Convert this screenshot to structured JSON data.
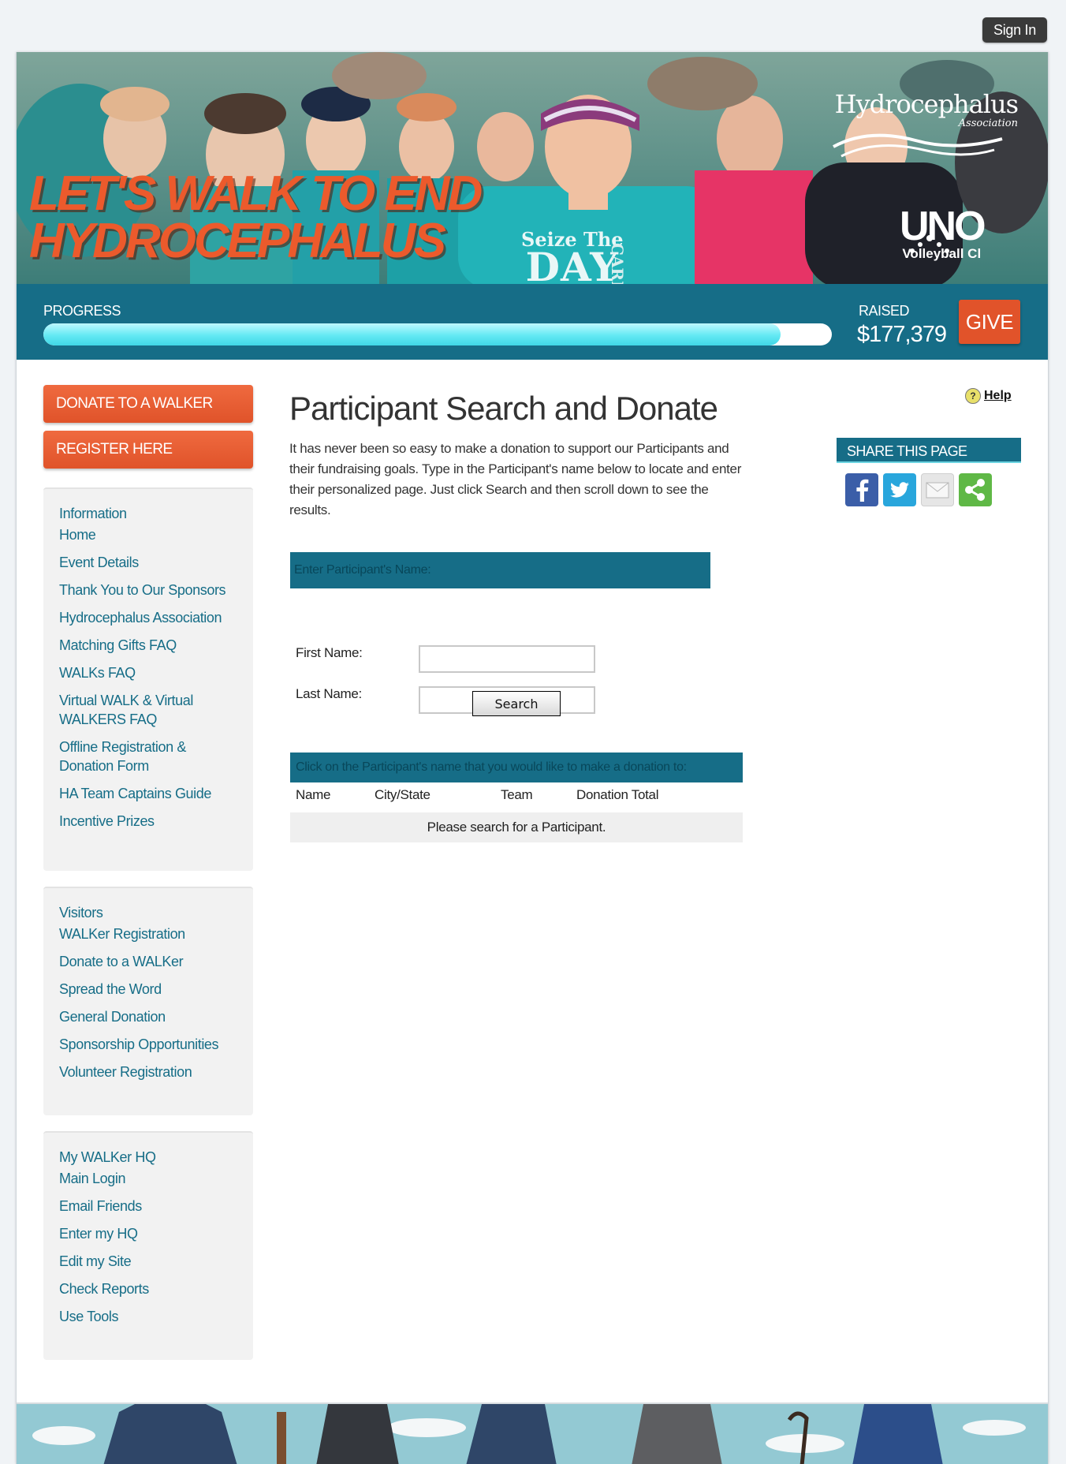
{
  "header": {
    "signin_label": "Sign In"
  },
  "banner": {
    "headline_line1": "LET'S WALK TO END",
    "headline_line2": "HYDROCEPHALUS",
    "tshirt_line1": "Seize The",
    "tshirt_line2": "DAY",
    "tshirt_line3": "CARP",
    "hoodie_line1": "UNO",
    "hoodie_line2": "Volleyball Cl",
    "logo_name": "Hydrocephalus",
    "logo_sub": "Association"
  },
  "progress": {
    "label": "PROGRESS",
    "fraction": 0.935,
    "raised_label": "RAISED",
    "raised_amount": "$177,379",
    "give_label": "GIVE"
  },
  "sidebar": {
    "donate_button": "DONATE TO A WALKER",
    "register_button": "REGISTER HERE",
    "sections": [
      {
        "heading": "Information",
        "items": [
          "Home",
          "Event Details",
          "Thank You to Our Sponsors",
          "Hydrocephalus Association",
          "Matching Gifts FAQ",
          "WALKs FAQ",
          "Virtual WALK & Virtual WALKERS FAQ",
          "Offline Registration & Donation Form",
          "HA Team Captains Guide",
          "Incentive Prizes"
        ]
      },
      {
        "heading": "Visitors",
        "items": [
          "WALKer Registration",
          "Donate to a WALKer",
          "Spread the Word",
          "General Donation",
          "Sponsorship Opportunities",
          "Volunteer Registration"
        ]
      },
      {
        "heading": "My WALKer HQ",
        "items": [
          "Main Login",
          "Email Friends",
          "Enter my HQ",
          "Edit my Site",
          "Check Reports",
          "Use Tools"
        ]
      }
    ]
  },
  "main": {
    "title": "Participant Search and Donate",
    "intro": "It has never been so easy to make a donation to support our Participants and their fundraising goals. Type in the Participant's name below to locate and enter their personalized page. Just click Search and then scroll down to see the results.",
    "help_label": "Help",
    "share_heading": "SHARE THIS PAGE",
    "share_icons": [
      "facebook-icon",
      "twitter-icon",
      "email-icon",
      "share-icon"
    ],
    "form": {
      "heading": "Enter Participant's Name:",
      "first_name_label": "First Name:",
      "first_name_value": "",
      "last_name_label": "Last Name:",
      "last_name_value": "",
      "search_button": "Search"
    },
    "results": {
      "heading": "Click on the Participant's name that you would like to make a donation to:",
      "columns": [
        "Name",
        "City/State",
        "Team",
        "Donation Total"
      ],
      "empty_message": "Please search for a Participant."
    }
  },
  "colors": {
    "primary_teal": "#166d87",
    "accent_orange": "#e1532a",
    "progress_fill": "#63e9f3",
    "nav_bg": "#f2f2f2"
  }
}
